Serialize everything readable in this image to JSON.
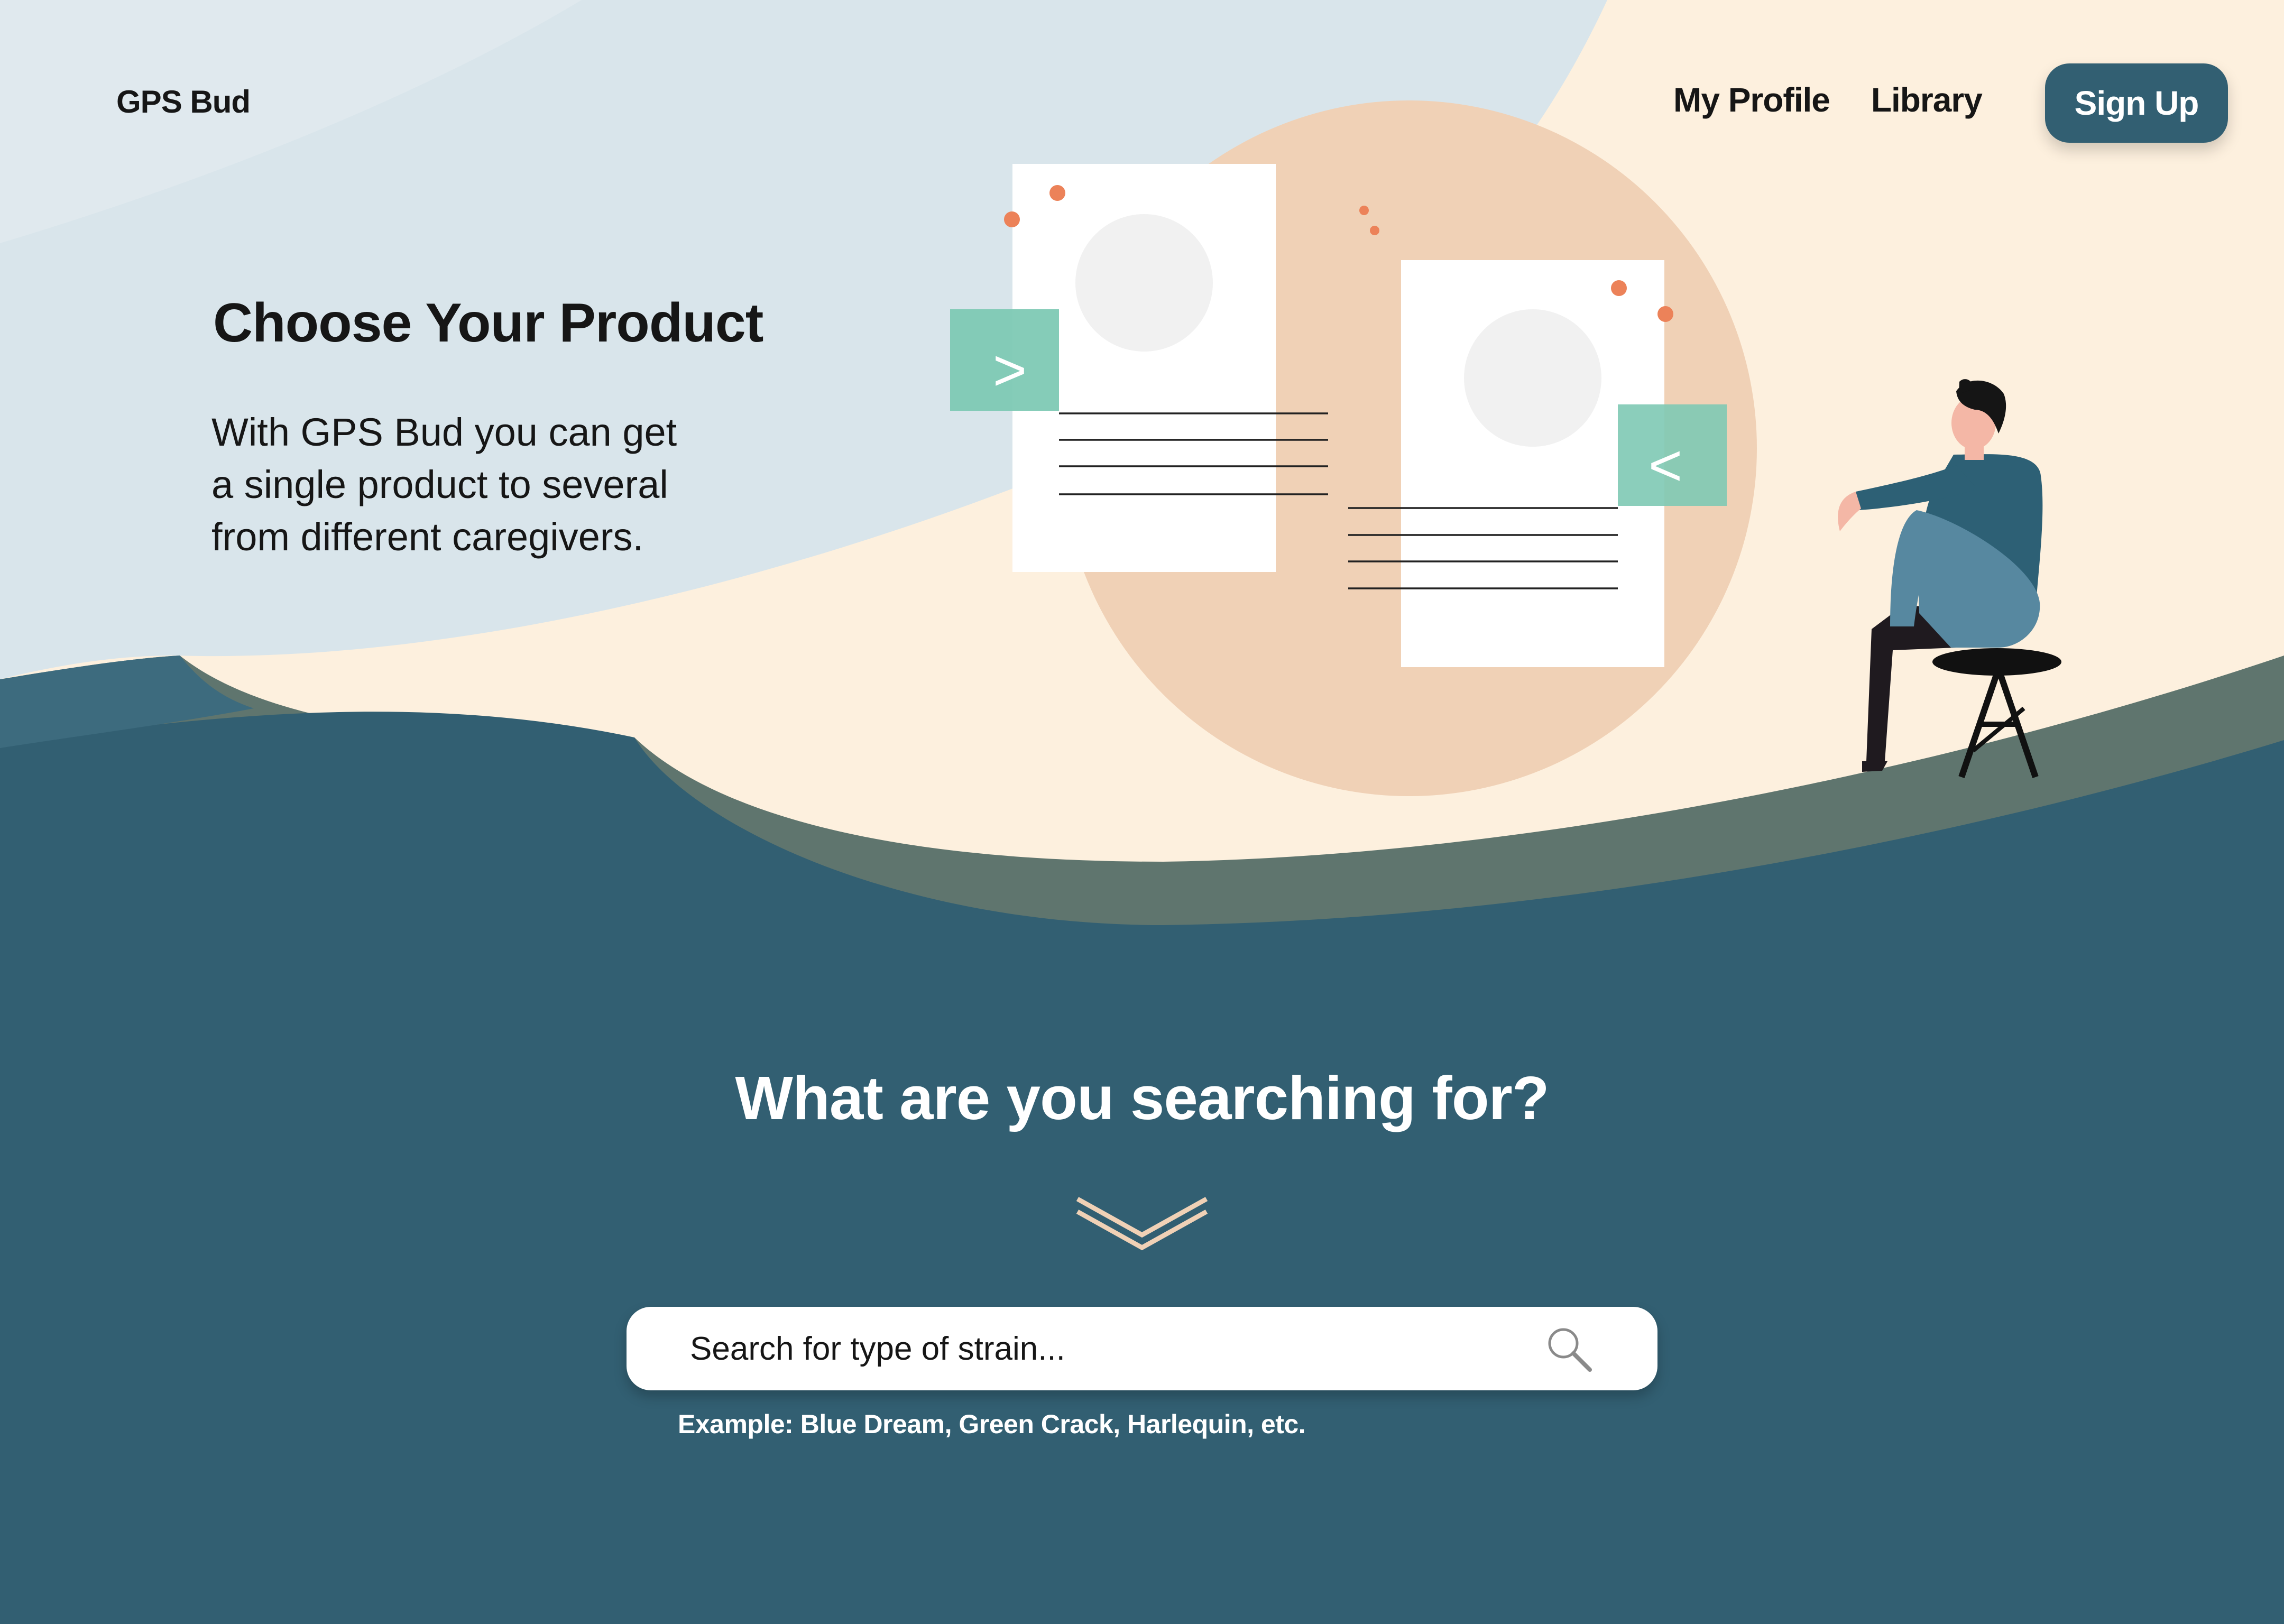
{
  "nav": {
    "logo": "GPS Bud",
    "links": [
      "My Profile",
      "Library"
    ],
    "signup_label": "Sign Up"
  },
  "hero": {
    "title": "Choose Your Product",
    "text_lines": [
      "With GPS Bud you can get",
      "a single product to several",
      "from different caregivers."
    ],
    "card_left_arrow": ">",
    "card_right_arrow": "<"
  },
  "search": {
    "title": "What are you searching for?",
    "placeholder": "Search for type of strain...",
    "example": "Example: Blue Dream, Green Crack, Harlequin, etc."
  },
  "colors": {
    "light_blue": "#d9e5eb",
    "cream": "#fdf0de",
    "peach": "#f0d1b6",
    "teal_dark": "#325f72",
    "sage": "#5f756e",
    "mint": "#7ec9b4",
    "coral": "#ec8259"
  },
  "icons": [
    "search-icon",
    "chevron-down-icon"
  ]
}
